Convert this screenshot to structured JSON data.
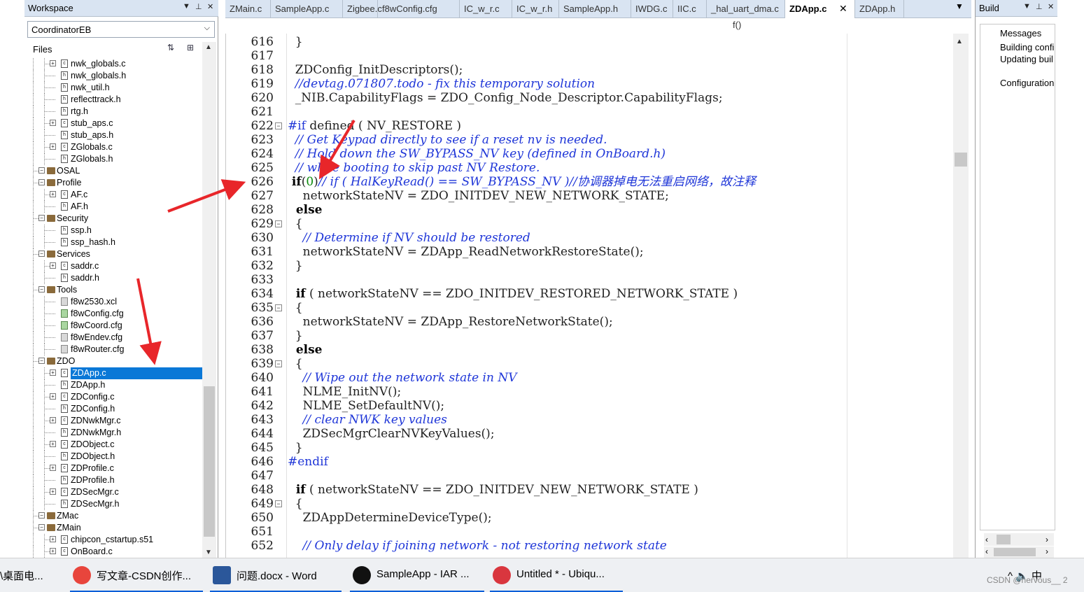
{
  "workspace": {
    "title": "Workspace",
    "combo": "CoordinatorEB",
    "files_label": "Files"
  },
  "tree": [
    {
      "label": "nwk_globals.c",
      "type": "c",
      "depth": 2,
      "exp": true
    },
    {
      "label": "nwk_globals.h",
      "type": "h",
      "depth": 2,
      "exp": false
    },
    {
      "label": "nwk_util.h",
      "type": "h",
      "depth": 2,
      "exp": false
    },
    {
      "label": "reflecttrack.h",
      "type": "h",
      "depth": 2,
      "exp": false
    },
    {
      "label": "rtg.h",
      "type": "h",
      "depth": 2,
      "exp": false
    },
    {
      "label": "stub_aps.c",
      "type": "c",
      "depth": 2,
      "exp": true
    },
    {
      "label": "stub_aps.h",
      "type": "h",
      "depth": 2,
      "exp": false
    },
    {
      "label": "ZGlobals.c",
      "type": "c",
      "depth": 2,
      "exp": true
    },
    {
      "label": "ZGlobals.h",
      "type": "h",
      "depth": 2,
      "exp": false
    },
    {
      "label": "OSAL",
      "type": "folder",
      "depth": 1,
      "exp": true
    },
    {
      "label": "Profile",
      "type": "folder",
      "depth": 1,
      "exp": true
    },
    {
      "label": "AF.c",
      "type": "c",
      "depth": 2,
      "exp": true
    },
    {
      "label": "AF.h",
      "type": "h",
      "depth": 2,
      "exp": false
    },
    {
      "label": "Security",
      "type": "folder",
      "depth": 1,
      "exp": true
    },
    {
      "label": "ssp.h",
      "type": "h",
      "depth": 2,
      "exp": false
    },
    {
      "label": "ssp_hash.h",
      "type": "h",
      "depth": 2,
      "exp": false
    },
    {
      "label": "Services",
      "type": "folder",
      "depth": 1,
      "exp": true
    },
    {
      "label": "saddr.c",
      "type": "c",
      "depth": 2,
      "exp": true
    },
    {
      "label": "saddr.h",
      "type": "h",
      "depth": 2,
      "exp": false
    },
    {
      "label": "Tools",
      "type": "folder",
      "depth": 1,
      "exp": true
    },
    {
      "label": "f8w2530.xcl",
      "type": "x",
      "depth": 2,
      "exp": false
    },
    {
      "label": "f8wConfig.cfg",
      "type": "g",
      "depth": 2,
      "exp": false
    },
    {
      "label": "f8wCoord.cfg",
      "type": "g",
      "depth": 2,
      "exp": false
    },
    {
      "label": "f8wEndev.cfg",
      "type": "x",
      "depth": 2,
      "exp": false
    },
    {
      "label": "f8wRouter.cfg",
      "type": "x",
      "depth": 2,
      "exp": false
    },
    {
      "label": "ZDO",
      "type": "folder",
      "depth": 1,
      "exp": true
    },
    {
      "label": "ZDApp.c",
      "type": "c",
      "depth": 2,
      "exp": true,
      "selected": true
    },
    {
      "label": "ZDApp.h",
      "type": "h",
      "depth": 2,
      "exp": false
    },
    {
      "label": "ZDConfig.c",
      "type": "c",
      "depth": 2,
      "exp": true
    },
    {
      "label": "ZDConfig.h",
      "type": "h",
      "depth": 2,
      "exp": false
    },
    {
      "label": "ZDNwkMgr.c",
      "type": "c",
      "depth": 2,
      "exp": true
    },
    {
      "label": "ZDNwkMgr.h",
      "type": "h",
      "depth": 2,
      "exp": false
    },
    {
      "label": "ZDObject.c",
      "type": "c",
      "depth": 2,
      "exp": true
    },
    {
      "label": "ZDObject.h",
      "type": "h",
      "depth": 2,
      "exp": false
    },
    {
      "label": "ZDProfile.c",
      "type": "c",
      "depth": 2,
      "exp": true
    },
    {
      "label": "ZDProfile.h",
      "type": "h",
      "depth": 2,
      "exp": false
    },
    {
      "label": "ZDSecMgr.c",
      "type": "c",
      "depth": 2,
      "exp": true
    },
    {
      "label": "ZDSecMgr.h",
      "type": "h",
      "depth": 2,
      "exp": false
    },
    {
      "label": "ZMac",
      "type": "folder",
      "depth": 1,
      "exp": true
    },
    {
      "label": "ZMain",
      "type": "folder",
      "depth": 1,
      "exp": true
    },
    {
      "label": "chipcon_cstartup.s51",
      "type": "c",
      "depth": 2,
      "exp": true
    },
    {
      "label": "OnBoard.c",
      "type": "c",
      "depth": 2,
      "exp": true
    }
  ],
  "tabs": [
    "ZMain.c",
    "SampleApp.c",
    "Zigbee.c",
    "f8wConfig.cfg",
    "IC_w_r.c",
    "IC_w_r.h",
    "SampleApp.h",
    "IWDG.c",
    "IIC.c",
    "_hal_uart_dma.c",
    "ZDApp.c",
    "ZDApp.h"
  ],
  "active_tab": "ZDApp.c",
  "func_icon": "f()",
  "code": [
    {
      "n": "616",
      "fold": false,
      "parts": [
        [
          "t",
          "  }"
        ]
      ]
    },
    {
      "n": "617",
      "fold": false,
      "parts": [
        [
          "t",
          ""
        ]
      ]
    },
    {
      "n": "618",
      "fold": false,
      "parts": [
        [
          "t",
          "  ZDConfig_InitDescriptors();"
        ]
      ]
    },
    {
      "n": "619",
      "fold": false,
      "parts": [
        [
          "c",
          "  //devtag.071807.todo - fix this temporary solution"
        ]
      ]
    },
    {
      "n": "620",
      "fold": false,
      "parts": [
        [
          "t",
          "  _NIB.CapabilityFlags = ZDO_Config_Node_Descriptor.CapabilityFlags;"
        ]
      ]
    },
    {
      "n": "621",
      "fold": false,
      "parts": [
        [
          "t",
          ""
        ]
      ]
    },
    {
      "n": "622",
      "fold": true,
      "parts": [
        [
          "p",
          "#if"
        ],
        [
          "t",
          " defined ( NV_RESTORE )"
        ]
      ]
    },
    {
      "n": "623",
      "fold": false,
      "parts": [
        [
          "c",
          "  // Get Keypad directly to see if a reset nv is needed."
        ]
      ]
    },
    {
      "n": "624",
      "fold": false,
      "parts": [
        [
          "c",
          "  // Hold down the SW_BYPASS_NV key (defined in OnBoard.h)"
        ]
      ]
    },
    {
      "n": "625",
      "fold": false,
      "parts": [
        [
          "c",
          "  // while booting to skip past NV Restore."
        ]
      ]
    },
    {
      "n": "626",
      "fold": false,
      "parts": [
        [
          "k",
          " if"
        ],
        [
          "t",
          "("
        ],
        [
          "n",
          "0"
        ],
        [
          "t",
          ")"
        ],
        [
          "c",
          "// if ( HalKeyRead() == SW_BYPASS_NV )//协调器掉电无法重启网络，故注释"
        ]
      ]
    },
    {
      "n": "627",
      "fold": false,
      "parts": [
        [
          "t",
          "    networkStateNV = ZDO_INITDEV_NEW_NETWORK_STATE;"
        ]
      ]
    },
    {
      "n": "628",
      "fold": false,
      "parts": [
        [
          "k",
          "  else"
        ]
      ]
    },
    {
      "n": "629",
      "fold": true,
      "parts": [
        [
          "t",
          "  {"
        ]
      ]
    },
    {
      "n": "630",
      "fold": false,
      "parts": [
        [
          "c",
          "    // Determine if NV should be restored"
        ]
      ]
    },
    {
      "n": "631",
      "fold": false,
      "parts": [
        [
          "t",
          "    networkStateNV = ZDApp_ReadNetworkRestoreState();"
        ]
      ]
    },
    {
      "n": "632",
      "fold": false,
      "parts": [
        [
          "t",
          "  }"
        ]
      ]
    },
    {
      "n": "633",
      "fold": false,
      "parts": [
        [
          "t",
          ""
        ]
      ]
    },
    {
      "n": "634",
      "fold": false,
      "parts": [
        [
          "k",
          "  if"
        ],
        [
          "t",
          " ( networkStateNV == ZDO_INITDEV_RESTORED_NETWORK_STATE )"
        ]
      ]
    },
    {
      "n": "635",
      "fold": true,
      "parts": [
        [
          "t",
          "  {"
        ]
      ]
    },
    {
      "n": "636",
      "fold": false,
      "parts": [
        [
          "t",
          "    networkStateNV = ZDApp_RestoreNetworkState();"
        ]
      ]
    },
    {
      "n": "637",
      "fold": false,
      "parts": [
        [
          "t",
          "  }"
        ]
      ]
    },
    {
      "n": "638",
      "fold": false,
      "parts": [
        [
          "k",
          "  else"
        ]
      ]
    },
    {
      "n": "639",
      "fold": true,
      "parts": [
        [
          "t",
          "  {"
        ]
      ]
    },
    {
      "n": "640",
      "fold": false,
      "parts": [
        [
          "c",
          "    // Wipe out the network state in NV"
        ]
      ]
    },
    {
      "n": "641",
      "fold": false,
      "parts": [
        [
          "t",
          "    NLME_InitNV();"
        ]
      ]
    },
    {
      "n": "642",
      "fold": false,
      "parts": [
        [
          "t",
          "    NLME_SetDefaultNV();"
        ]
      ]
    },
    {
      "n": "643",
      "fold": false,
      "parts": [
        [
          "c",
          "    // clear NWK key values"
        ]
      ]
    },
    {
      "n": "644",
      "fold": false,
      "parts": [
        [
          "t",
          "    ZDSecMgrClearNVKeyValues();"
        ]
      ]
    },
    {
      "n": "645",
      "fold": false,
      "parts": [
        [
          "t",
          "  }"
        ]
      ]
    },
    {
      "n": "646",
      "fold": false,
      "parts": [
        [
          "p",
          "#endif"
        ]
      ]
    },
    {
      "n": "647",
      "fold": false,
      "parts": [
        [
          "t",
          ""
        ]
      ]
    },
    {
      "n": "648",
      "fold": false,
      "parts": [
        [
          "k",
          "  if"
        ],
        [
          "t",
          " ( networkStateNV == ZDO_INITDEV_NEW_NETWORK_STATE )"
        ]
      ]
    },
    {
      "n": "649",
      "fold": true,
      "parts": [
        [
          "t",
          "  {"
        ]
      ]
    },
    {
      "n": "650",
      "fold": false,
      "parts": [
        [
          "t",
          "    ZDAppDetermineDeviceType();"
        ]
      ]
    },
    {
      "n": "651",
      "fold": false,
      "parts": [
        [
          "t",
          ""
        ]
      ]
    },
    {
      "n": "652",
      "fold": false,
      "parts": [
        [
          "c",
          "    // Only delay if joining network - not restoring network state"
        ]
      ]
    }
  ],
  "build": {
    "title": "Build",
    "messages": [
      "Messages",
      "Building confi",
      "Updating buil",
      "",
      "Configuration"
    ]
  },
  "taskbar": [
    {
      "label": "\\桌面电...",
      "icon": "#e6e6e6"
    },
    {
      "label": "写文章-CSDN创作...",
      "icon": "#e8453c"
    },
    {
      "label": "问题.docx - Word",
      "icon": "#2b579a"
    },
    {
      "label": "SampleApp - IAR ...",
      "icon": "#111111"
    },
    {
      "label": "Untitled * - Ubiqu...",
      "icon": "#d9363e"
    }
  ],
  "tray": {
    "text": "^ 🔈 中",
    "wm": "CSDN @nervous__ 2"
  },
  "colors": {
    "accent": "#0a78d7",
    "arrow": "#e8262a",
    "comment": "#1f36d8"
  }
}
